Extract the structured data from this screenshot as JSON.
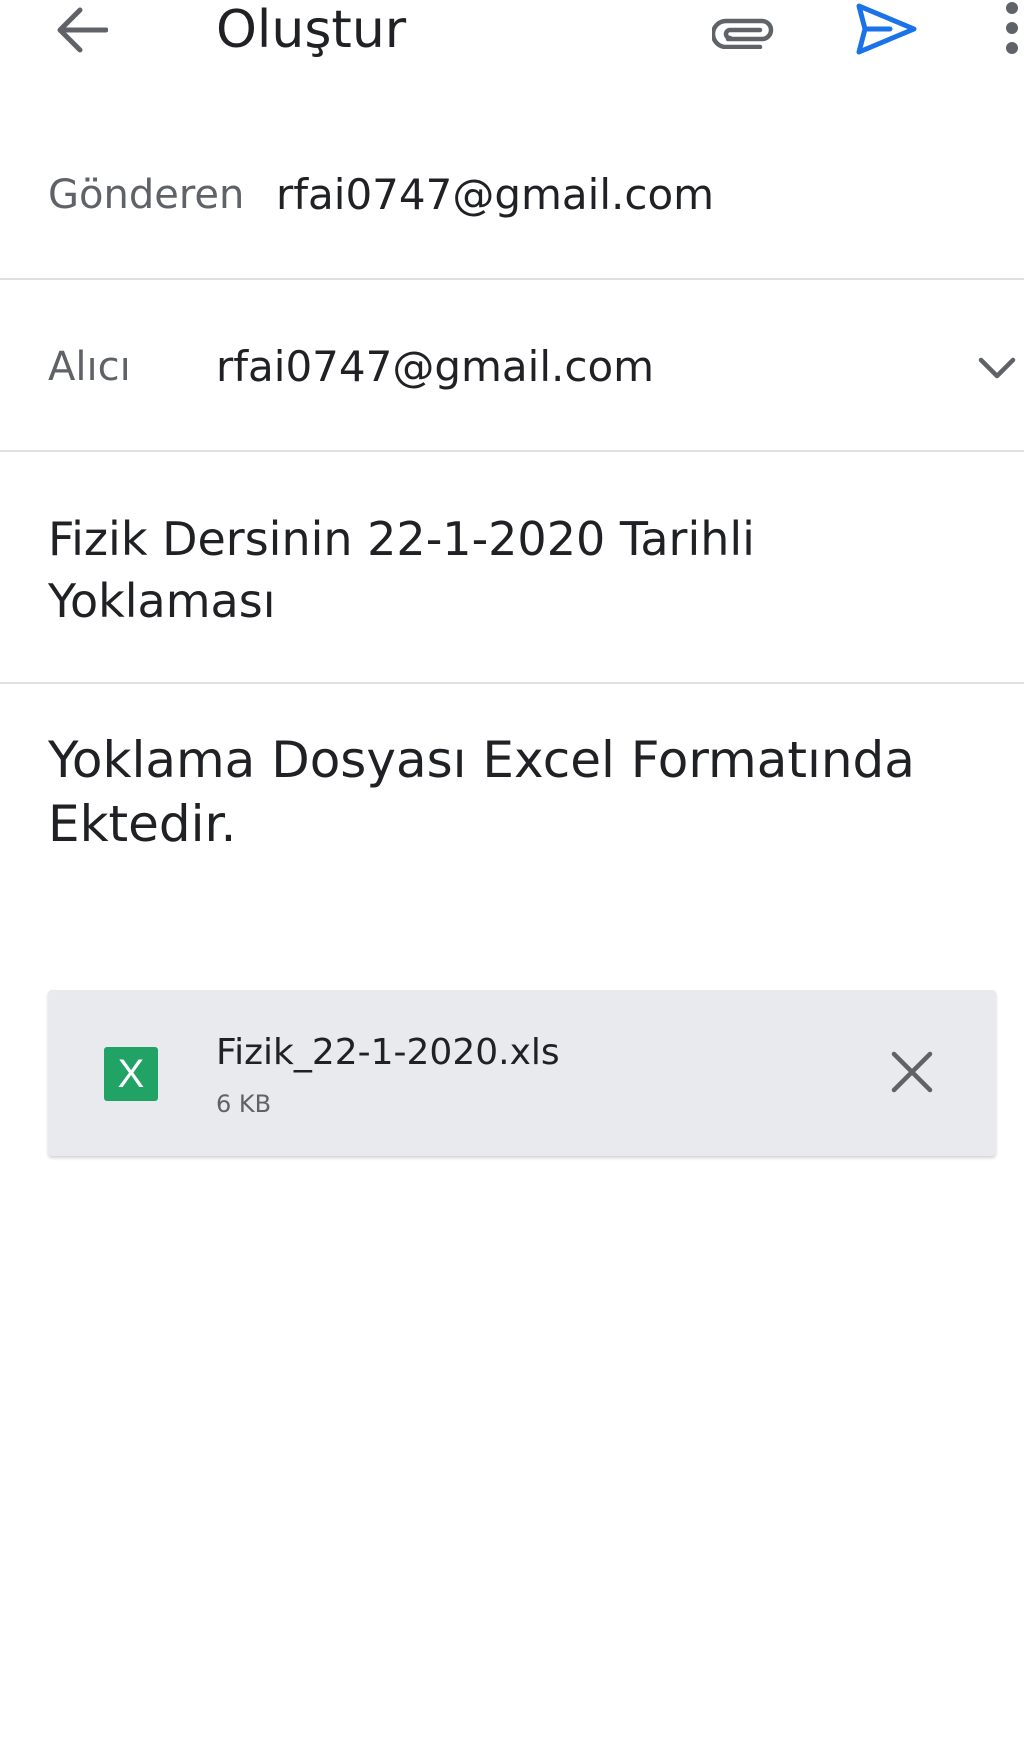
{
  "toolbar": {
    "back_icon": "arrow-back-icon",
    "title": "Oluştur",
    "attach_icon": "paperclip-icon",
    "send_icon": "send-icon",
    "more_icon": "more-vert-icon"
  },
  "from": {
    "label": "Gönderen",
    "value": "rfai0747@gmail.com"
  },
  "to": {
    "label": "Alıcı",
    "value": "rfai0747@gmail.com",
    "expand_icon": "chevron-down-icon"
  },
  "subject": {
    "line1": "Fizik Dersinin 22-1-2020 Tarihli",
    "line2": "Yoklaması"
  },
  "body": {
    "line1": "Yoklama Dosyası Excel Formatında",
    "line2": "Ektedir."
  },
  "attachment": {
    "icon_letter": "X",
    "file_name": "Fizik_22-1-2020.xls",
    "file_size": "6 KB",
    "remove_icon": "close-icon"
  },
  "colors": {
    "accent": "#1a73e8",
    "icon_gray": "#5f6368",
    "text": "#202124",
    "card_bg": "#e8eaed",
    "excel_green": "#21a366"
  }
}
